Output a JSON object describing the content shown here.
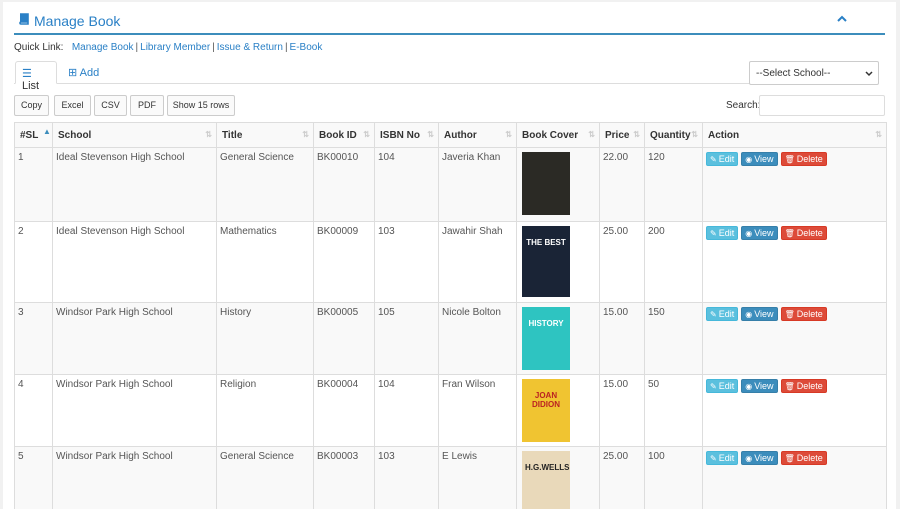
{
  "header": {
    "title": "Manage Book"
  },
  "quick_links": {
    "label": "Quick Link:",
    "links": [
      "Manage Book",
      "Library Member",
      "Issue & Return",
      "E-Book"
    ]
  },
  "tabs": {
    "list": "List",
    "add": "Add"
  },
  "school_select": {
    "value": "--Select School--"
  },
  "export_buttons": {
    "copy": "Copy",
    "excel": "Excel",
    "csv": "CSV",
    "pdf": "PDF",
    "show": "Show 15 rows"
  },
  "search": {
    "label": "Search:"
  },
  "table": {
    "headers": [
      "#SL",
      "School",
      "Title",
      "Book ID",
      "ISBN No",
      "Author",
      "Book Cover",
      "Price",
      "Quantity",
      "Action"
    ],
    "rows": [
      {
        "sl": "1",
        "school": "Ideal Stevenson High School",
        "title": "General Science",
        "book_id": "BK00010",
        "isbn": "104",
        "author": "Javeria Khan",
        "price": "22.00",
        "quantity": "120"
      },
      {
        "sl": "2",
        "school": "Ideal Stevenson High School",
        "title": "Mathematics",
        "book_id": "BK00009",
        "isbn": "103",
        "author": "Jawahir Shah",
        "price": "25.00",
        "quantity": "200"
      },
      {
        "sl": "3",
        "school": "Windsor Park High School",
        "title": "History",
        "book_id": "BK00005",
        "isbn": "105",
        "author": "Nicole Bolton",
        "price": "15.00",
        "quantity": "150"
      },
      {
        "sl": "4",
        "school": "Windsor Park High School",
        "title": "Religion",
        "book_id": "BK00004",
        "isbn": "104",
        "author": "Fran Wilson",
        "price": "15.00",
        "quantity": "50"
      },
      {
        "sl": "5",
        "school": "Windsor Park High School",
        "title": "General Science",
        "book_id": "BK00003",
        "isbn": "103",
        "author": "E Lewis",
        "price": "25.00",
        "quantity": "100"
      }
    ],
    "covers": [
      {
        "text": "",
        "bg": "#2b2a25"
      },
      {
        "text": "THE BEST",
        "bg": "#1a2436"
      },
      {
        "text": "HISTORY",
        "bg": "#2ec4c1"
      },
      {
        "text": "JOAN DIDION",
        "bg": "#f0c431"
      },
      {
        "text": "H.G.WELLS",
        "bg": "#e9d9ba"
      }
    ],
    "actions": {
      "edit": "Edit",
      "view": "View",
      "delete": "Delete"
    }
  },
  "colors": {
    "primary": "#3c8dbc",
    "info": "#5bc0de",
    "danger": "#dd4b39",
    "link": "#2a80c6"
  }
}
